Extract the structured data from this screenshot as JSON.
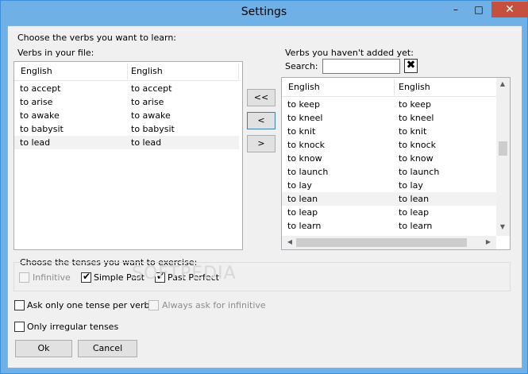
{
  "window": {
    "title": "Settings"
  },
  "titlebar": {
    "minimize": "–",
    "maximize": "□",
    "close": "✕"
  },
  "main": {
    "instruction": "Choose the verbs you want to learn:",
    "in_file_label": "Verbs in your file:",
    "not_added_label": "Verbs you haven't added yet:",
    "search_label": "Search:",
    "search_value": "",
    "search_clear": "✖"
  },
  "left_list": {
    "columns": [
      "English",
      "English"
    ],
    "rows": [
      [
        "to accept",
        "to accept"
      ],
      [
        "to arise",
        "to arise"
      ],
      [
        "to awake",
        "to awake"
      ],
      [
        "to babysit",
        "to babysit"
      ],
      [
        "to lead",
        "to lead"
      ]
    ]
  },
  "right_list": {
    "columns": [
      "English",
      "English"
    ],
    "rows": [
      [
        "to keep",
        "to keep"
      ],
      [
        "to kneel",
        "to kneel"
      ],
      [
        "to knit",
        "to knit"
      ],
      [
        "to knock",
        "to knock"
      ],
      [
        "to know",
        "to know"
      ],
      [
        "to launch",
        "to launch"
      ],
      [
        "to lay",
        "to lay"
      ],
      [
        "to lean",
        "to lean"
      ],
      [
        "to leap",
        "to leap"
      ],
      [
        "to learn",
        "to learn"
      ]
    ]
  },
  "transfer_buttons": {
    "all_left": "<<",
    "left": "<",
    "right": ">"
  },
  "tenses": {
    "label": "Choose the tenses you want to exercise:",
    "infinitive": "Infinitive",
    "simple_past": "Simple Past",
    "past_perfect": "Past Perfect",
    "watermark": "SOFTPEDIA"
  },
  "options": {
    "one_tense": "Ask only one tense per verb",
    "always_infinitive": "Always ask for infinitive",
    "only_irregular": "Only irregular tenses"
  },
  "footer": {
    "ok": "Ok",
    "cancel": "Cancel"
  }
}
